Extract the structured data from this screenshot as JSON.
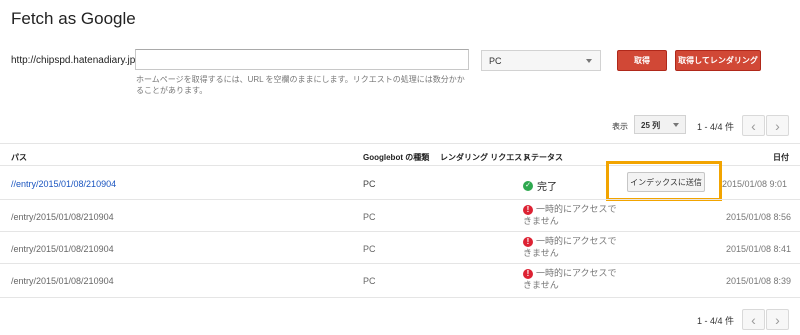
{
  "page": {
    "title": "Fetch as Google"
  },
  "fetch_form": {
    "url_prefix": "http://chipspd.hatenadiary.jp/",
    "url_value": "",
    "hint": "ホームページを取得するには、URL を空欄のままにします。リクエストの処理には数分かかることがあります。",
    "device_select": "PC",
    "fetch_label": "取得",
    "fetch_render_label": "取得してレンダリング"
  },
  "pagination": {
    "show_label": "表示",
    "rows_per_page": "25 列",
    "range_text": "1 - 4/4 件",
    "prev_icon": "chevron-left-icon",
    "next_icon": "chevron-right-icon"
  },
  "table": {
    "headers": {
      "path": "パス",
      "googlebot_type": "Googlebot の種類",
      "render_request": "レンダリング リクエスト",
      "status": "ステータス",
      "date": "日付"
    },
    "rows": [
      {
        "path": "//entry/2015/01/08/210904",
        "type": "PC",
        "status": "完了",
        "status_kind": "success",
        "date": "2015/01/08 9:01"
      },
      {
        "path": "/entry/2015/01/08/210904",
        "type": "PC",
        "status": "一時的にアクセスできません",
        "status_line1": "一時的にアクセスで",
        "status_line2": "きません",
        "status_kind": "error",
        "date": "2015/01/08 8:56"
      },
      {
        "path": "/entry/2015/01/08/210904",
        "type": "PC",
        "status": "一時的にアクセスできません",
        "status_line1": "一時的にアクセスで",
        "status_line2": "きません",
        "status_kind": "error",
        "date": "2015/01/08 8:41"
      },
      {
        "path": "/entry/2015/01/08/210904",
        "type": "PC",
        "status": "一時的にアクセスできません",
        "status_line1": "一時的にアクセスで",
        "status_line2": "きません",
        "status_kind": "error",
        "date": "2015/01/08 8:39"
      }
    ],
    "submit_index_label": "インデックスに送信"
  },
  "colors": {
    "accent_red": "#d14836",
    "highlight": "#f2a400",
    "success": "#2ea84f",
    "error": "#dd2233",
    "link": "#1a55c0"
  }
}
